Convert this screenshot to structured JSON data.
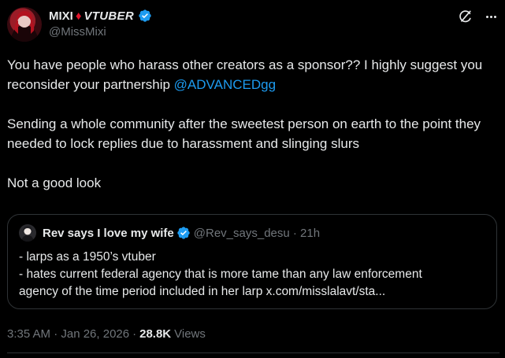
{
  "author": {
    "name": "MIXI",
    "diamond": "♦",
    "tag": "VTUBER",
    "handle": "@MissMixi"
  },
  "tweet": {
    "line1": "You have people who harass other creators as a sponsor?? I highly suggest you reconsider your partnership ",
    "mention": "@ADVANCEDgg",
    "para2": "Sending a whole community after the sweetest person on earth to the point they needed to lock replies due to harassment and slinging slurs",
    "para3": "Not a good look"
  },
  "quote": {
    "name": "Rev says I love my wife",
    "handle": "@Rev_says_desu · 21h",
    "lines": [
      "- larps as a 1950’s vtuber",
      "- hates current federal agency that is more tame than any law enforcement",
      "agency of the time period included in her larp x.com/misslalavt/sta..."
    ]
  },
  "meta": {
    "timestamp": "3:35 AM · Jan 26, 2026",
    "separator": "·",
    "views_count": "28.8K",
    "views_label": "Views"
  },
  "colors": {
    "background": "#000000",
    "text": "#e7e9ea",
    "muted": "#71767b",
    "link": "#1d9bf0",
    "verified": "#1d9bf0",
    "diamond": "#e0142b",
    "border": "#2f3336"
  },
  "icons": {
    "verified": "verified-badge-icon",
    "grok": "grok-icon",
    "more": "more-options-icon"
  }
}
